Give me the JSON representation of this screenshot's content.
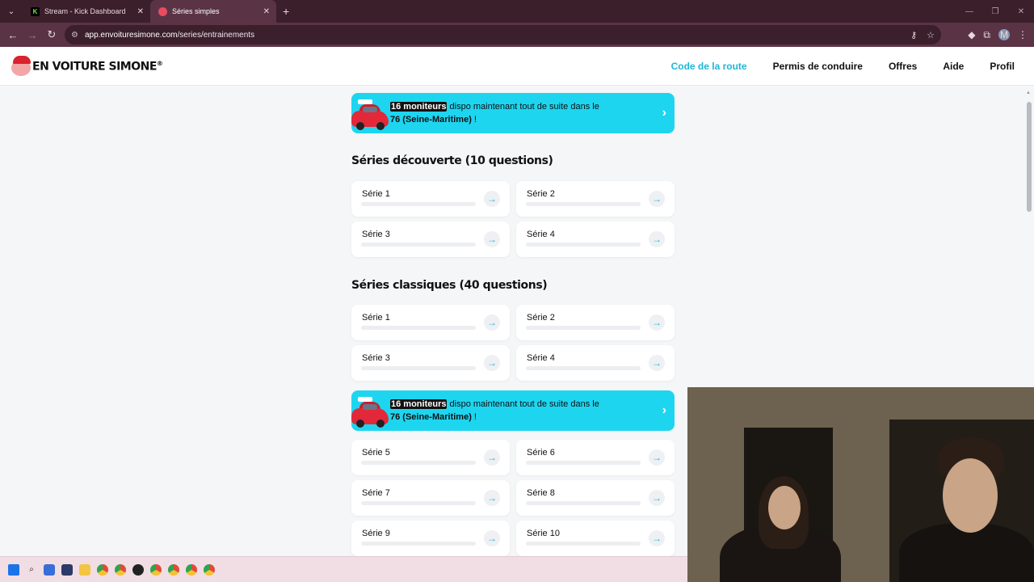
{
  "browser": {
    "tabs": [
      {
        "label": "Stream - Kick Dashboard",
        "icon": "kick-icon",
        "active": false
      },
      {
        "label": "Séries simples",
        "icon": "simone-icon",
        "active": true
      }
    ],
    "url_host": "app.envoituresimone.com",
    "url_path": "/series/entrainements",
    "profile_initial": "M"
  },
  "site": {
    "logo_text": "EN VOITURE SIMONE",
    "logo_mark": "®",
    "nav": [
      {
        "label": "Code de la route",
        "active": true
      },
      {
        "label": "Permis de conduire",
        "active": false
      },
      {
        "label": "Offres",
        "active": false
      },
      {
        "label": "Aide",
        "active": false
      },
      {
        "label": "Profil",
        "active": false
      }
    ]
  },
  "promo": {
    "highlight": "16 moniteurs",
    "text_mid": " dispo maintenant tout de suite dans le ",
    "location": "76 (Seine-Maritime)",
    "text_end": " !"
  },
  "sections": [
    {
      "title": "Séries découverte (10 questions)",
      "series": [
        "Série 1",
        "Série 2",
        "Série 3",
        "Série 4"
      ]
    },
    {
      "title": "Séries classiques (40 questions)",
      "series": [
        "Série 1",
        "Série 2",
        "Série 3",
        "Série 4"
      ],
      "series_after_promo": [
        "Série 5",
        "Série 6",
        "Série 7",
        "Série 8",
        "Série 9",
        "Série 10"
      ]
    }
  ],
  "colors": {
    "accent": "#1eb6d6",
    "promo_bg": "#1ed5f0",
    "page_bg": "#f4f6f8"
  }
}
